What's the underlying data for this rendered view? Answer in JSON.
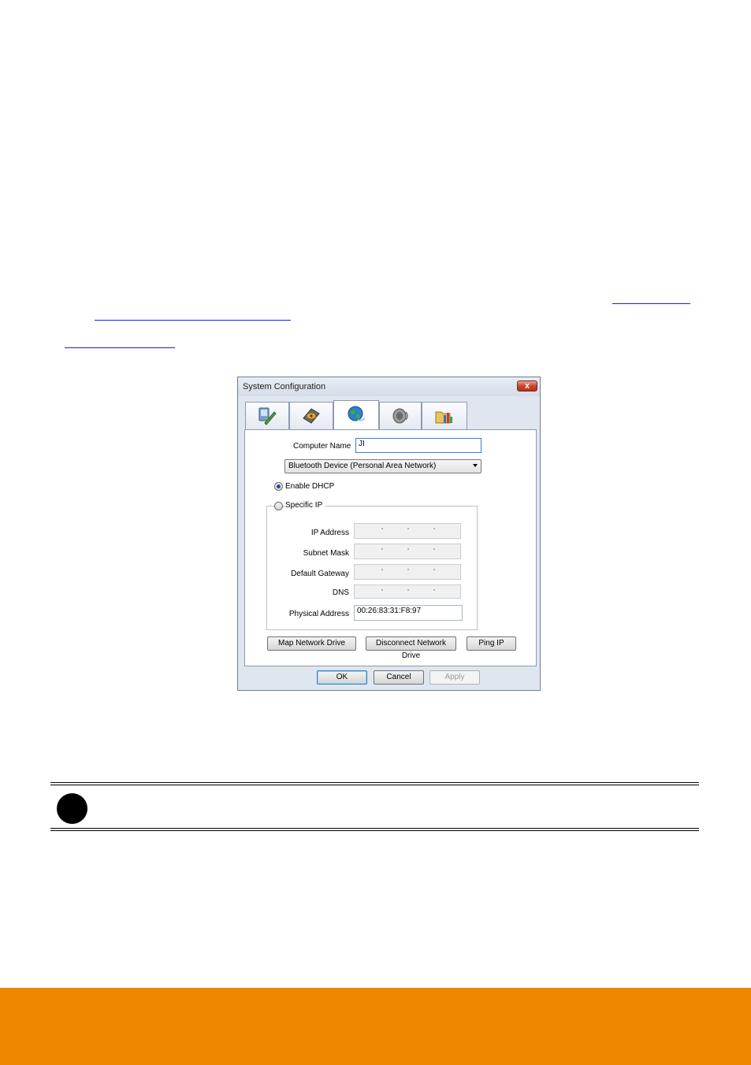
{
  "dialog": {
    "title": "System Configuration",
    "close_glyph": "x",
    "tabs": [
      {
        "icon": "monitor-tools-icon",
        "active": false
      },
      {
        "icon": "hard-disk-icon",
        "active": false
      },
      {
        "icon": "network-globe-icon",
        "active": true
      },
      {
        "icon": "speaker-icon",
        "active": false
      },
      {
        "icon": "folder-bars-icon",
        "active": false
      }
    ],
    "computer_name_label": "Computer Name",
    "computer_name_value": "JI",
    "adapter_selected": "Bluetooth Device (Personal Area Network)",
    "enable_dhcp_label": "Enable DHCP",
    "specific_ip_label": "Specific IP",
    "ip_address_label": "IP Address",
    "subnet_mask_label": "Subnet Mask",
    "default_gateway_label": "Default Gateway",
    "dns_label": "DNS",
    "physical_address_label": "Physical Address",
    "physical_address_value": "00:26:83:31:F8:97",
    "map_network_drive_label": "Map Network Drive",
    "disconnect_network_drive_label": "Disconnect Network Drive",
    "ping_ip_label": "Ping IP",
    "ok_label": "OK",
    "cancel_label": "Cancel",
    "apply_label": "Apply"
  },
  "colors": {
    "footer_band": "#ef8700",
    "link_underline": "#1a1aff"
  }
}
